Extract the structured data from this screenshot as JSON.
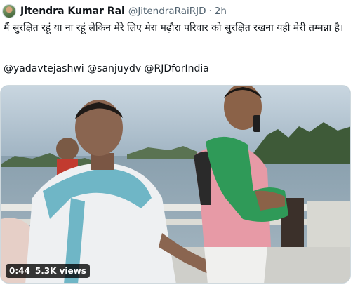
{
  "tweet": {
    "author_name": "Jitendra Kumar Rai",
    "handle": "@JitendraRaiRJD",
    "separator": "·",
    "time": "2h",
    "text": "मैं सुरक्षित रहूं या ना रहूं लेकिन मेरे लिए मेरा मढ़ौरा परिवार को सुरक्षित रखना यही मेरी तम्मन्ना है।",
    "mentions": "@yadavtejashwi @sanjuydv @RJDforIndia"
  },
  "video": {
    "duration": "0:44",
    "views": "5.3K views"
  },
  "colors": {
    "text": "#0f1419",
    "secondary": "#536471",
    "border": "#cfd9de"
  }
}
